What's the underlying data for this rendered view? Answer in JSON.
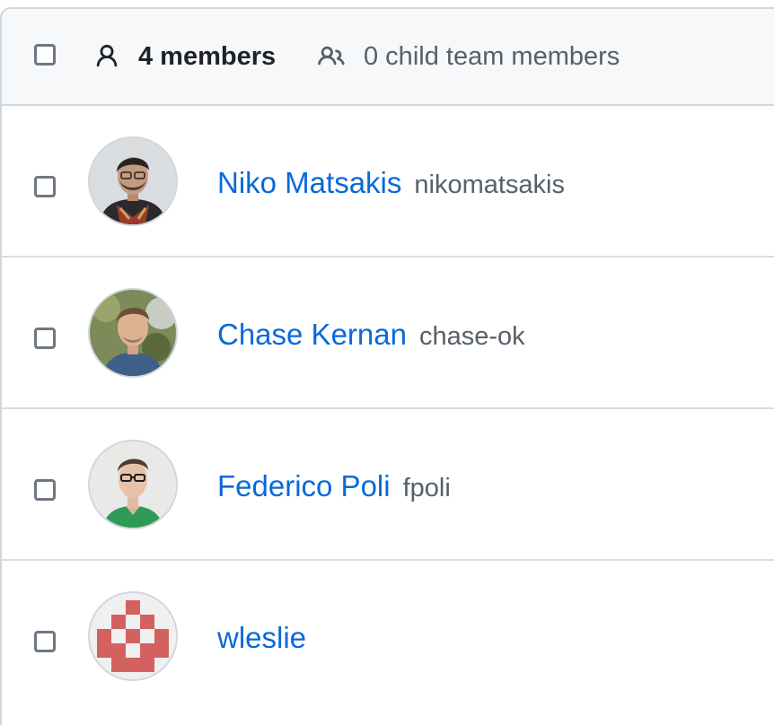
{
  "header": {
    "members_count": "4 members",
    "child_team_members": "0 child team members",
    "select_all_checked": false,
    "person_icon": "person-icon",
    "people_icon": "people-icon"
  },
  "members": [
    {
      "full_name": "Niko Matsakis",
      "login": "nikomatsakis",
      "checked": false
    },
    {
      "full_name": "Chase Kernan",
      "login": "chase-ok",
      "checked": false
    },
    {
      "full_name": "Federico Poli",
      "login": "fpoli",
      "checked": false
    },
    {
      "full_name": "",
      "login": "wleslie",
      "checked": false
    }
  ],
  "colors": {
    "link": "#0969da",
    "muted": "#57606a",
    "border": "#d0d7de",
    "header_bg": "#f6f8fa",
    "identicon": "#d3615f"
  }
}
